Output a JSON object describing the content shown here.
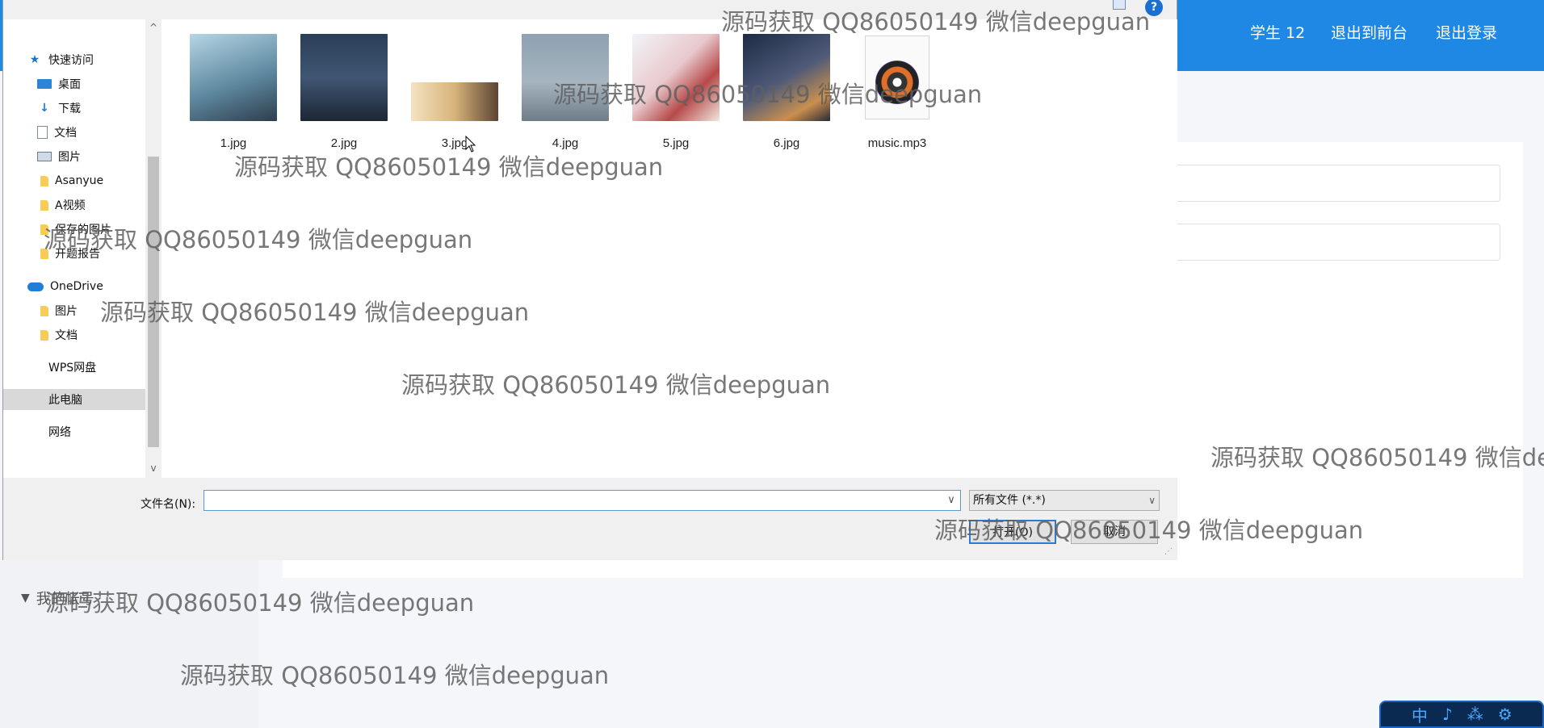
{
  "app": {
    "header": {
      "student_label": "学生 12",
      "back_frontend_label": "退出到前台",
      "logout_label": "退出登录",
      "color": "#1f88e5"
    },
    "sidebar": {
      "partial_item": "我的帐号"
    }
  },
  "dialog": {
    "nav": {
      "quick_access": "快速访问",
      "items": [
        "桌面",
        "下载",
        "文档",
        "图片",
        "Asanyue",
        "A视频",
        "保存的图片",
        "开题报告"
      ],
      "onedrive": "OneDrive",
      "onedrive_items": [
        "图片",
        "文档"
      ],
      "wps": "WPS网盘",
      "this_pc": "此电脑",
      "network": "网络"
    },
    "files": [
      {
        "name": "1.jpg",
        "icon": "image-thumbnail"
      },
      {
        "name": "2.jpg",
        "icon": "image-thumbnail"
      },
      {
        "name": "3.jpg",
        "icon": "image-thumbnail"
      },
      {
        "name": "4.jpg",
        "icon": "image-thumbnail"
      },
      {
        "name": "5.jpg",
        "icon": "image-thumbnail"
      },
      {
        "name": "6.jpg",
        "icon": "image-thumbnail"
      },
      {
        "name": "music.mp3",
        "icon": "music-file-icon"
      }
    ],
    "filename_label": "文件名(N):",
    "filename_value": "",
    "filetype": "所有文件 (*.*)",
    "open_label": "打开(O)",
    "cancel_label": "取消",
    "help_label": "?"
  },
  "watermark": "源码获取 QQ86050149 微信deepguan"
}
